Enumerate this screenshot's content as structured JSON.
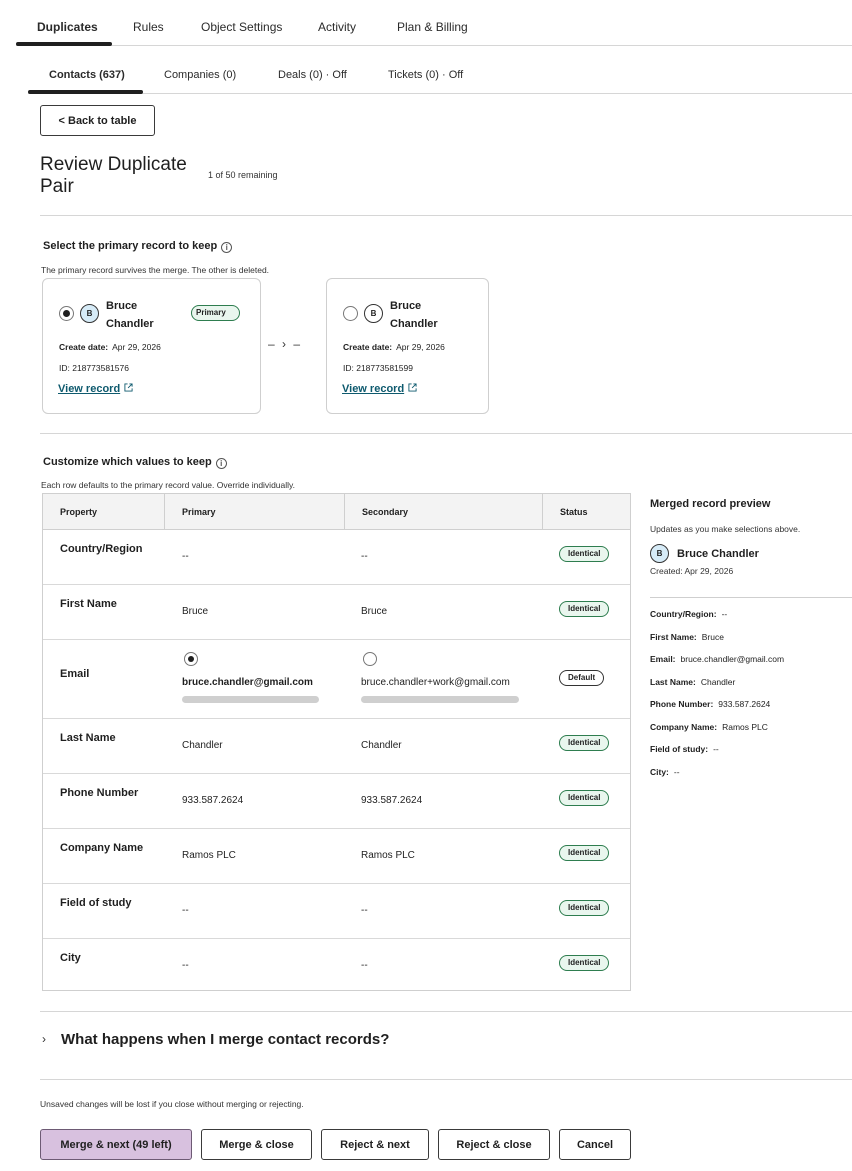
{
  "top_tabs": [
    {
      "label": "Duplicates",
      "active": true
    },
    {
      "label": "Rules"
    },
    {
      "label": "Object Settings"
    },
    {
      "label": "Activity"
    },
    {
      "label": "Plan & Billing"
    }
  ],
  "sub_tabs": [
    {
      "label": "Contacts (637)",
      "active": true
    },
    {
      "label": "Companies (0)"
    },
    {
      "label": "Deals (0) · Off"
    },
    {
      "label": "Tickets (0) · Off"
    }
  ],
  "back_button": "< Back to table",
  "page_title": "Review Duplicate Pair",
  "remaining": "1 of 50 remaining",
  "primary_section": {
    "title": "Select the primary record to keep",
    "description": "The primary record survives the merge. The other is deleted.",
    "info_icon": "ⓘ"
  },
  "records": [
    {
      "selected": true,
      "avatar": "B",
      "name": "Bruce Chandler",
      "badge": "Primary",
      "create_label": "Create date:",
      "create_date": "Apr 29, 2026",
      "id": "ID: 218773581576",
      "link": "View record"
    },
    {
      "selected": false,
      "avatar": "B",
      "name": "Bruce Chandler",
      "create_label": "Create date:",
      "create_date": "Apr 29, 2026",
      "id": "ID: 218773581599",
      "link": "View record"
    }
  ],
  "arrow_between": "– › –",
  "values_section": {
    "title": "Customize which values to keep",
    "description": "Each row defaults to the primary record value. Override individually.",
    "info_icon": "ⓘ"
  },
  "table": {
    "headers": [
      "Property",
      "Primary",
      "Secondary",
      "Status"
    ],
    "rows": [
      {
        "property": "Country/Region",
        "primary": "--",
        "secondary": "--",
        "status": "Identical"
      },
      {
        "property": "First Name",
        "primary": "Bruce",
        "secondary": "Bruce",
        "status": "Identical"
      },
      {
        "property": "Email",
        "primary": "bruce.chandler@gmail.com",
        "secondary": "bruce.chandler+work@gmail.com",
        "status": "Default",
        "choice": true
      },
      {
        "property": "Last Name",
        "primary": "Chandler",
        "secondary": "Chandler",
        "status": "Identical"
      },
      {
        "property": "Phone Number",
        "primary": "933.587.2624",
        "secondary": "933.587.2624",
        "status": "Identical"
      },
      {
        "property": "Company Name",
        "primary": "Ramos PLC",
        "secondary": "Ramos PLC",
        "status": "Identical"
      },
      {
        "property": "Field of study",
        "primary": "--",
        "secondary": "--",
        "status": "Identical"
      },
      {
        "property": "City",
        "primary": "--",
        "secondary": "--",
        "status": "Identical"
      }
    ]
  },
  "preview": {
    "title": "Merged record preview",
    "description": "Updates as you make selections above.",
    "avatar": "B",
    "name": "Bruce Chandler",
    "created": "Created: Apr 29, 2026",
    "fields": [
      {
        "label": "Country/Region:",
        "value": "--"
      },
      {
        "label": "First Name:",
        "value": "Bruce"
      },
      {
        "label": "Email:",
        "value": "bruce.chandler@gmail.com"
      },
      {
        "label": "Last Name:",
        "value": "Chandler"
      },
      {
        "label": "Phone Number:",
        "value": "933.587.2624"
      },
      {
        "label": "Company Name:",
        "value": "Ramos PLC"
      },
      {
        "label": "Field of study:",
        "value": "--"
      },
      {
        "label": "City:",
        "value": "--"
      }
    ]
  },
  "accordion": {
    "chevron": "›",
    "label": "What happens when I merge contact records?"
  },
  "unsaved_note": "Unsaved changes will be lost if you close without merging or rejecting.",
  "actions": {
    "merge_next": "Merge & next (49 left)",
    "merge_close": "Merge & close",
    "reject_next": "Reject & next",
    "reject_close": "Reject & close",
    "cancel": "Cancel"
  },
  "colors": {
    "primary_button": "#d8c1df",
    "badge_identical_border": "#2e7d4f",
    "link": "#0e5a6e",
    "avatar_selected": "#d6ebf7"
  }
}
